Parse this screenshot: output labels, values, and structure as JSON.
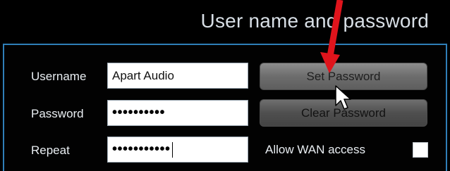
{
  "header": {
    "title": "User name and password"
  },
  "form": {
    "username_label": "Username",
    "username_value": "Apart Audio",
    "password_label": "Password",
    "password_value": "••••••••••",
    "repeat_label": "Repeat",
    "repeat_value": "•••••••••••"
  },
  "buttons": {
    "set_password": "Set Password",
    "clear_password": "Clear Password"
  },
  "options": {
    "allow_wan_label": "Allow WAN access",
    "allow_wan_checked": false
  },
  "colors": {
    "background": "#000000",
    "border_accent": "#2f7fb8",
    "annotation_arrow": "#e0141c"
  },
  "icons": [
    "mouse-pointer-icon",
    "red-arrow-annotation"
  ]
}
